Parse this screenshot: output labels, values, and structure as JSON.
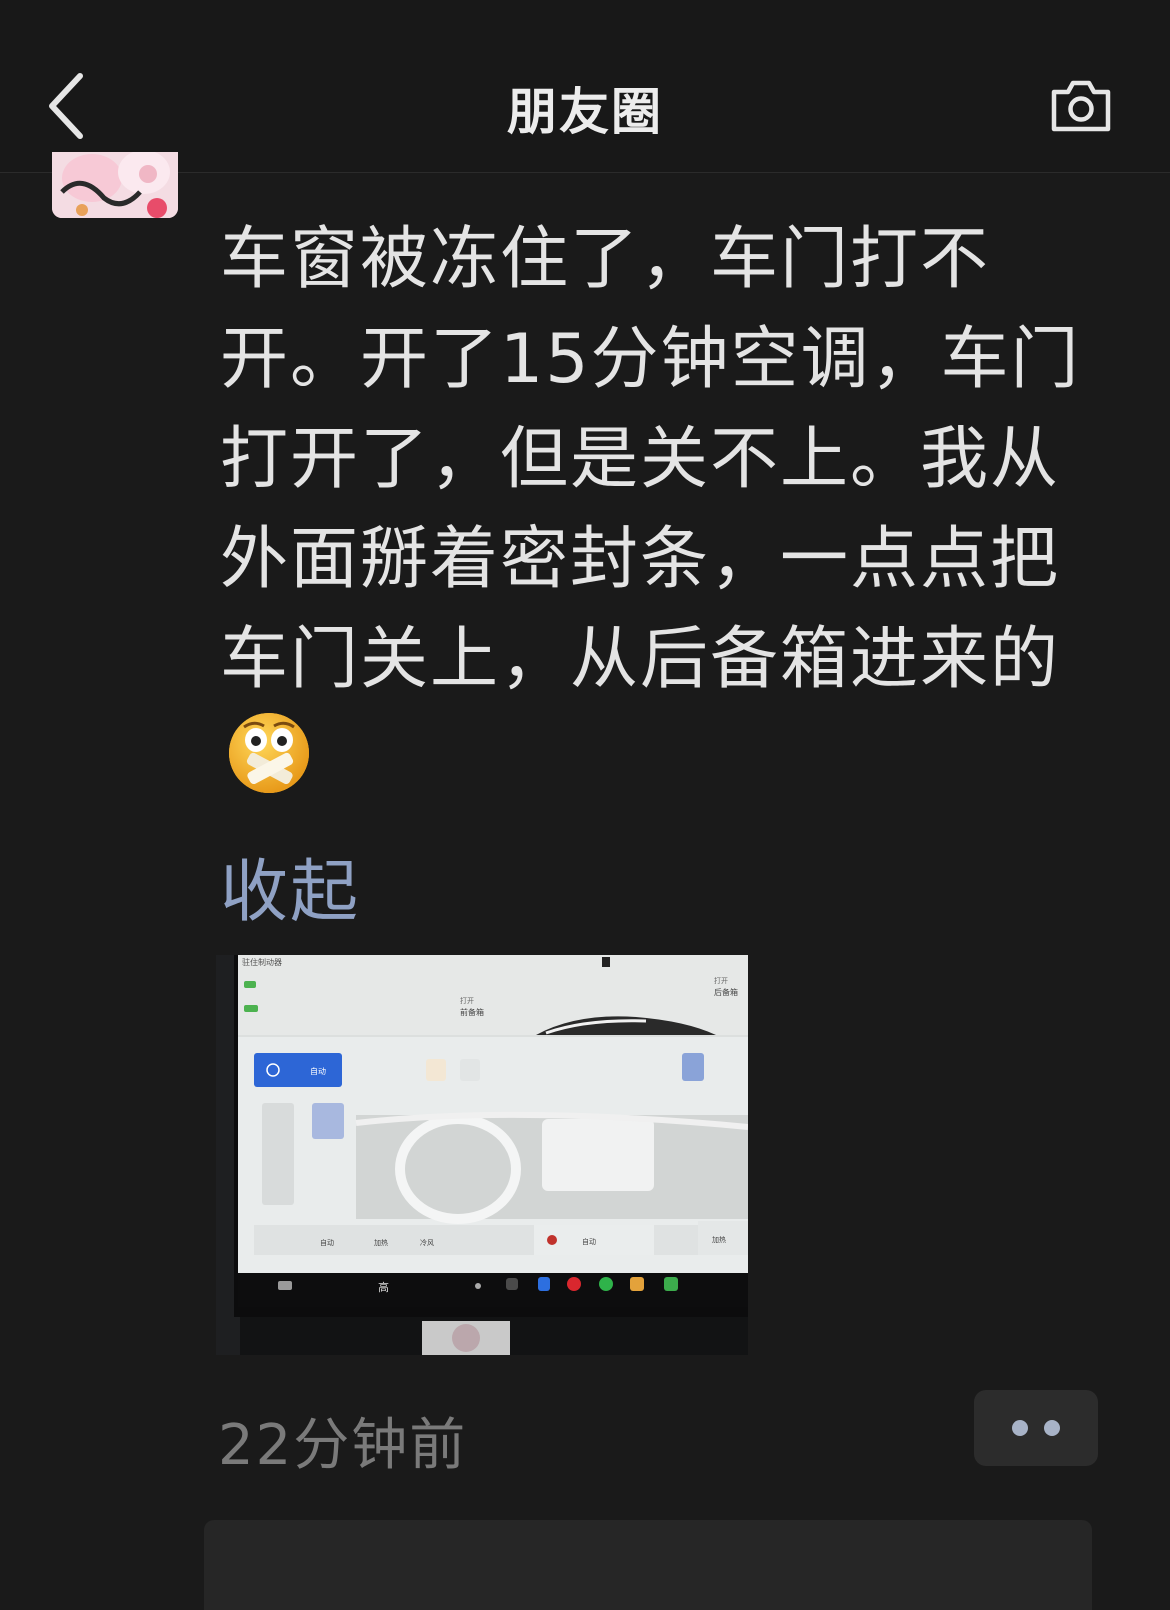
{
  "header": {
    "title": "朋友圈",
    "back_icon": "chevron-left-icon",
    "camera_icon": "camera-icon"
  },
  "post": {
    "text": "车窗被冻住了，车门打不开。开了15分钟空调，车门打开了，但是关不上。我从外面掰着密封条，一点点把车门关上，从后备箱进来的",
    "emoji": "shocked-face-emoji",
    "collapse_label": "收起",
    "time": "22分钟前",
    "photo": {
      "status_text": "驻住制动器",
      "trunk_label_top": "打开",
      "trunk_label": "前备箱",
      "rear_label_top": "打开",
      "rear_label": "后备箱",
      "power_label": "自动",
      "bottom_auto": "自动",
      "bottom_heat": "加热",
      "bottom_cool": "冷风",
      "bottom_auto2": "自动",
      "bottom_heat2": "加热",
      "fan_label": "高"
    }
  },
  "colors": {
    "background": "#1a1a1a",
    "header_bg": "#181818",
    "link": "#8fa1c4",
    "time": "#7a7a7a"
  }
}
